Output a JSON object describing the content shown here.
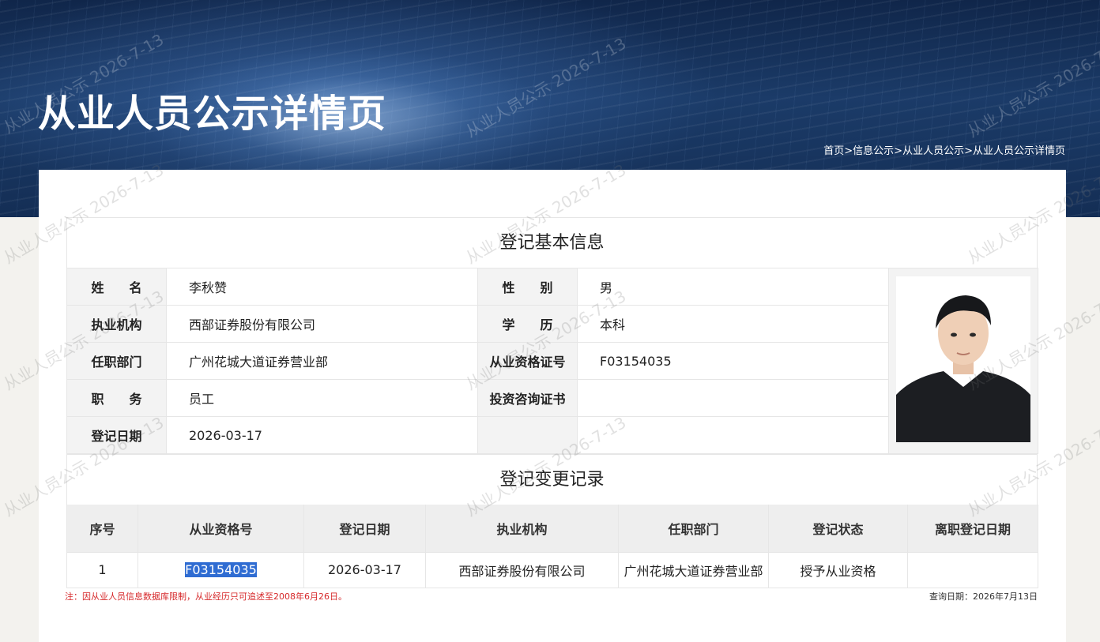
{
  "header": {
    "title": "从业人员公示详情页",
    "breadcrumb": [
      "首页",
      "信息公示",
      "从业人员公示",
      "从业人员公示详情页"
    ],
    "breadcrumb_separator": ">"
  },
  "basic_info": {
    "section_title": "登记基本信息",
    "rows": [
      {
        "label1": "姓　　名",
        "value1": "李秋赞",
        "label2": "性　　别",
        "value2": "男"
      },
      {
        "label1": "执业机构",
        "value1": "西部证券股份有限公司",
        "label2": "学　　历",
        "value2": "本科"
      },
      {
        "label1": "任职部门",
        "value1": "广州花城大道证券营业部",
        "label2": "从业资格证号",
        "value2": "F03154035"
      },
      {
        "label1": "职　　务",
        "value1": "员工",
        "label2": "投资咨询证书",
        "value2": ""
      },
      {
        "label1": "登记日期",
        "value1": "2026-03-17",
        "label2": "",
        "value2": ""
      }
    ],
    "photo": {
      "alt": "portrait-photo"
    }
  },
  "change_records": {
    "section_title": "登记变更记录",
    "columns": [
      "序号",
      "从业资格号",
      "登记日期",
      "执业机构",
      "任职部门",
      "登记状态",
      "离职登记日期"
    ],
    "rows": [
      [
        "1",
        "F03154035",
        "2026-03-17",
        "西部证券股份有限公司",
        "广州花城大道证券营业部",
        "授予从业资格",
        ""
      ]
    ]
  },
  "footer": {
    "note": "注：因从业人员信息数据库限制，从业经历只可追述至2008年6月26日。",
    "query_date": "查询日期：2026年7月13日"
  },
  "watermark": {
    "text": "从业人员公示 2026-7-13"
  },
  "colors": {
    "banner_dark": "#10264a",
    "note_red": "#d6282a",
    "highlight_blue": "#2f6cd2"
  }
}
